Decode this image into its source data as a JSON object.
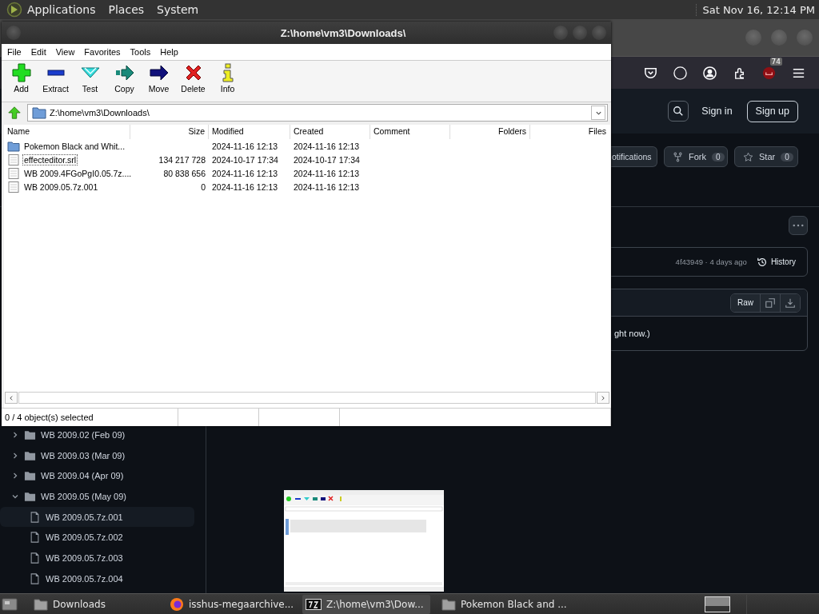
{
  "top_panel": {
    "menus": [
      "Applications",
      "Places",
      "System"
    ],
    "clock": "Sat Nov 16, 12:14 PM"
  },
  "browser": {
    "extension_badge": "74",
    "header": {
      "sign_in": "Sign in",
      "sign_up": "Sign up"
    },
    "repo_actions": [
      {
        "kind": "notifications",
        "label": "otifications"
      },
      {
        "kind": "fork",
        "label": "Fork",
        "count": "0"
      },
      {
        "kind": "star",
        "label": "Star",
        "count": "0"
      }
    ],
    "commit": {
      "info": "4f43949 · 4 days ago",
      "history": "History"
    },
    "file_header": {
      "raw": "Raw"
    },
    "file_text": "ght now.)",
    "tree": [
      {
        "label": "WB 2009.02 (Feb 09)",
        "expanded": false
      },
      {
        "label": "WB 2009.03 (Mar 09)",
        "expanded": false
      },
      {
        "label": "WB 2009.04 (Apr 09)",
        "expanded": false
      },
      {
        "label": "WB 2009.05 (May 09)",
        "expanded": true,
        "children": [
          {
            "label": "WB 2009.05.7z.001",
            "selected": true
          },
          {
            "label": "WB 2009.05.7z.002",
            "selected": false
          },
          {
            "label": "WB 2009.05.7z.003",
            "selected": false
          },
          {
            "label": "WB 2009.05.7z.004",
            "selected": false
          }
        ]
      }
    ]
  },
  "archive_window": {
    "title": "Z:\\home\\vm3\\Downloads\\",
    "menu": [
      "File",
      "Edit",
      "View",
      "Favorites",
      "Tools",
      "Help"
    ],
    "toolbar": [
      {
        "kind": "add",
        "label": "Add"
      },
      {
        "kind": "extract",
        "label": "Extract"
      },
      {
        "kind": "test",
        "label": "Test"
      },
      {
        "kind": "copy",
        "label": "Copy"
      },
      {
        "kind": "move",
        "label": "Move"
      },
      {
        "kind": "delete",
        "label": "Delete"
      },
      {
        "kind": "info",
        "label": "Info"
      }
    ],
    "path": "Z:\\home\\vm3\\Downloads\\",
    "columns": [
      "Name",
      "Size",
      "Modified",
      "Created",
      "Comment",
      "Folders",
      "Files"
    ],
    "rows": [
      {
        "kind": "folder",
        "name": "Pokemon Black and Whit...",
        "modified": "2024-11-16 12:13",
        "created": "2024-11-16 12:13",
        "selected": false,
        "focused": false
      },
      {
        "kind": "file",
        "name": "effecteditor.srl",
        "size": "134 217 728",
        "modified": "2024-10-17 17:34",
        "created": "2024-10-17 17:34",
        "selected": false,
        "focused": true
      },
      {
        "kind": "file",
        "name": "WB 2009.4FGoPgI0.05.7z....",
        "size": "80 838 656",
        "modified": "2024-11-16 12:13",
        "created": "2024-11-16 12:13",
        "selected": false,
        "focused": false
      },
      {
        "kind": "file",
        "name": "WB 2009.05.7z.001",
        "size": "0",
        "modified": "2024-11-16 12:13",
        "created": "2024-11-16 12:13",
        "selected": false,
        "focused": false
      }
    ],
    "status": "0 / 4 object(s) selected"
  },
  "taskbar": [
    {
      "kind": "folder",
      "label": "Downloads",
      "selected": false
    },
    {
      "kind": "browser",
      "label": "isshus-megaarchive...",
      "selected": false
    },
    {
      "kind": "archiver",
      "label": "Z:\\home\\vm3\\Dow...",
      "selected": true
    },
    {
      "kind": "folder",
      "label": "Pokemon Black and ...",
      "selected": false
    }
  ]
}
